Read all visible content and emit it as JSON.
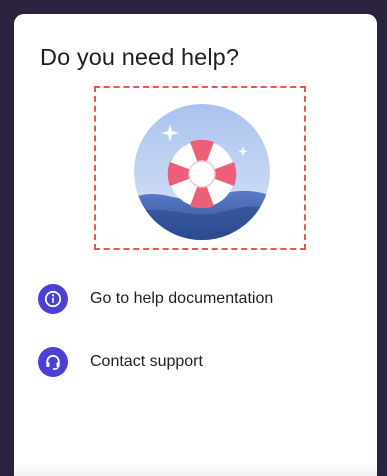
{
  "panel": {
    "title": "Do you need help?",
    "illustration_icon": "lifebuoy-icon",
    "accent_color": "#4b3fd6",
    "highlight_color": "#e8574a"
  },
  "help_items": [
    {
      "label": "Go to help documentation",
      "icon": "info-icon"
    },
    {
      "label": "Contact support",
      "icon": "headset-icon"
    }
  ]
}
